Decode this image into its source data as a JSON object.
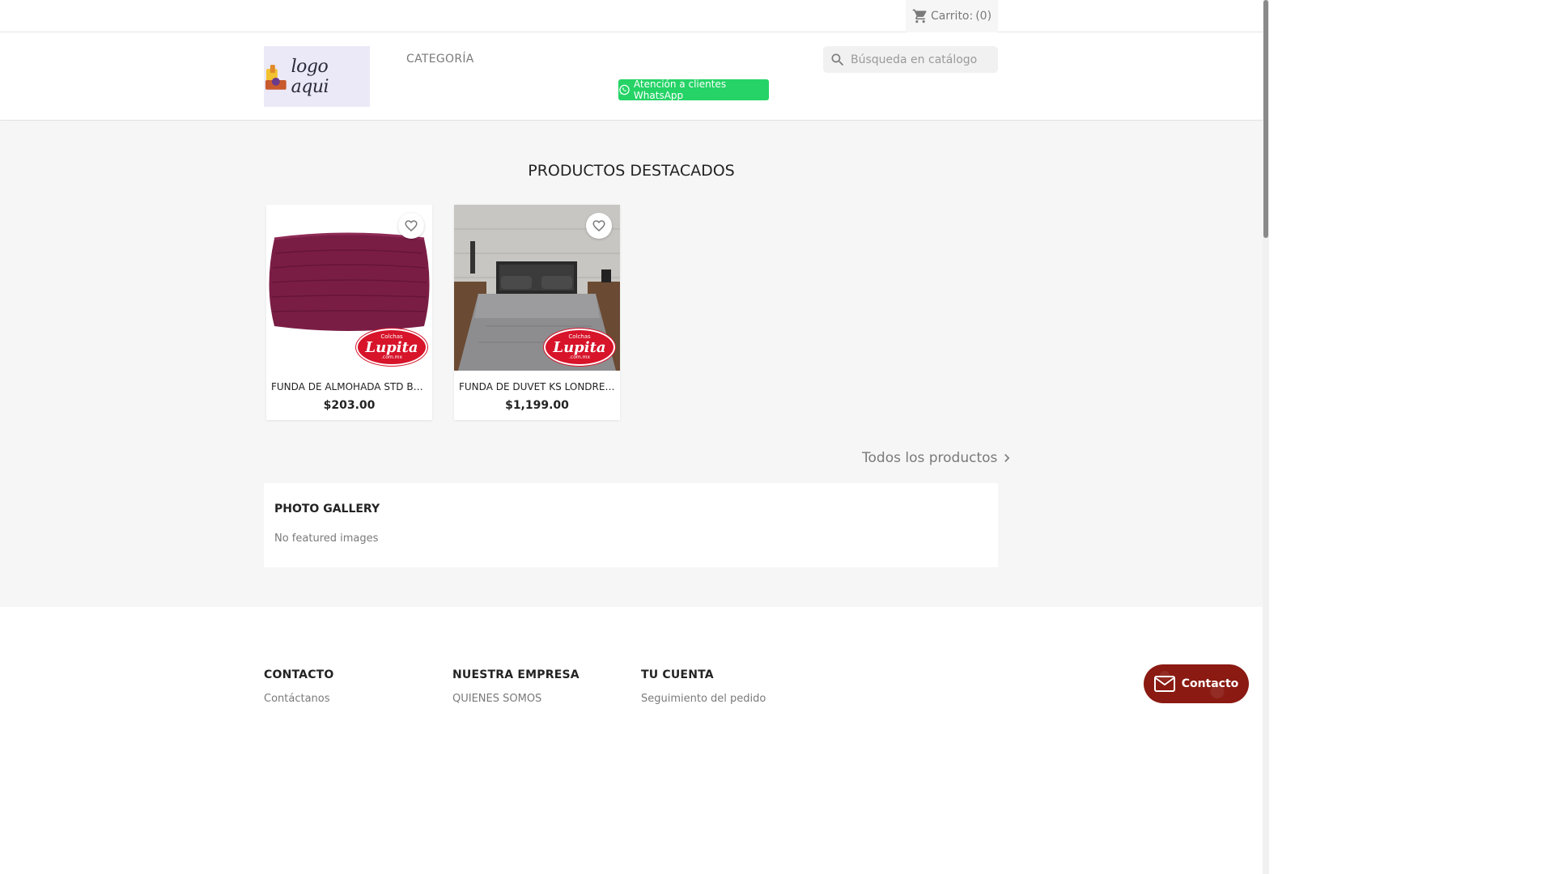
{
  "cart": {
    "label": "Carrito:",
    "count": "(0)"
  },
  "header": {
    "logo_text": "logo aqui",
    "menu_category": "CATEGORÍA",
    "whatsapp_label": "Atención a clientes WhatsApp",
    "search_placeholder": "Búsqueda en catálogo"
  },
  "featured": {
    "title": "PRODUCTOS DESTACADOS",
    "products": [
      {
        "name": "FUNDA DE ALMOHADA STD BASIC...",
        "price": "$203.00"
      },
      {
        "name": "FUNDA DE DUVET KS LONDRES...",
        "price": "$1,199.00"
      }
    ],
    "all_products_label": "Todos los productos"
  },
  "badge": {
    "line1": "Colchas",
    "brand": "Lupita",
    "line3": ".com.mx"
  },
  "gallery": {
    "title": "PHOTO GALLERY",
    "empty_text": "No featured images"
  },
  "footer": {
    "columns": [
      {
        "title": "CONTACTO",
        "links": [
          "Contáctanos"
        ]
      },
      {
        "title": "NUESTRA EMPRESA",
        "links": [
          "QUIENES SOMOS"
        ]
      },
      {
        "title": "TU CUENTA",
        "links": [
          "Seguimiento del pedido"
        ]
      }
    ]
  },
  "contact_widget": {
    "label": "Contacto"
  },
  "colors": {
    "whatsapp": "#25d366",
    "brand_red": "#d7142a",
    "pillow": "#7a1d45",
    "contact_widget": "#8a1a12"
  }
}
